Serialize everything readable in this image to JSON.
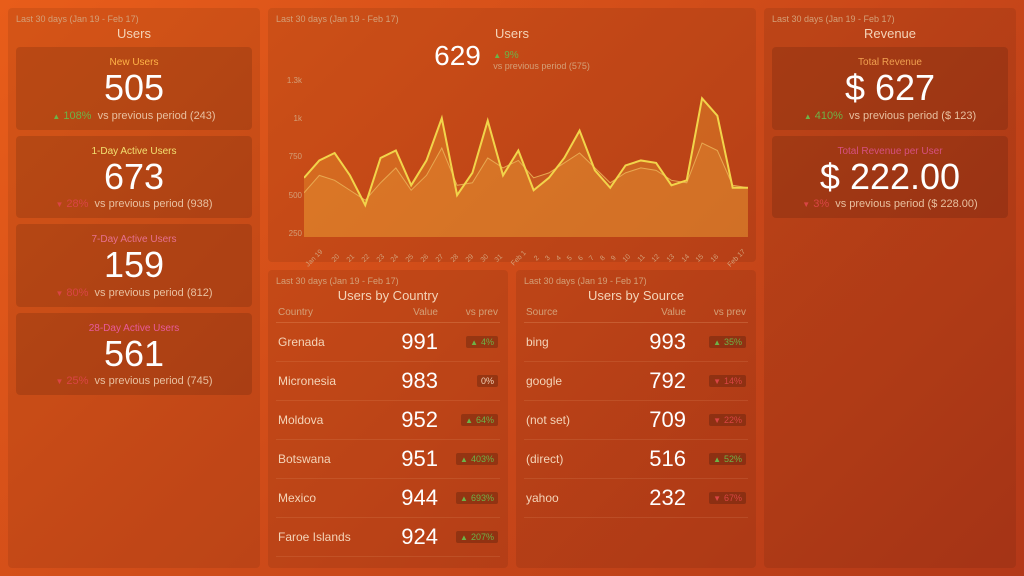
{
  "period": "Last 30 days (Jan 19 - Feb 17)",
  "users_section": {
    "title": "Users",
    "cards": [
      {
        "label": "New Users",
        "value": "505",
        "delta": "108%",
        "dir": "up",
        "prev": "vs previous period (243)"
      },
      {
        "label": "1-Day Active Users",
        "value": "673",
        "delta": "28%",
        "dir": "down",
        "prev": "vs previous period (938)"
      },
      {
        "label": "7-Day Active Users",
        "value": "159",
        "delta": "80%",
        "dir": "down",
        "prev": "vs previous period (812)"
      },
      {
        "label": "28-Day Active Users",
        "value": "561",
        "delta": "25%",
        "dir": "down",
        "prev": "vs previous period (745)"
      }
    ]
  },
  "revenue_section": {
    "title": "Revenue",
    "cards": [
      {
        "label": "Total Revenue",
        "value": "$ 627",
        "delta": "410%",
        "dir": "up",
        "prev": "vs previous period ($ 123)"
      },
      {
        "label": "Total Revenue per User",
        "value": "$ 222.00",
        "delta": "3%",
        "dir": "down",
        "prev": "vs previous period ($ 228.00)"
      }
    ]
  },
  "chart": {
    "title": "Users",
    "value": "629",
    "delta": "9%",
    "dir": "up",
    "prev": "vs previous period (575)"
  },
  "chart_data": {
    "type": "line",
    "title": "Users",
    "ylabel": "",
    "xlabel": "",
    "ylim": [
      0,
      1300
    ],
    "categories": [
      "Jan 19",
      "20",
      "21",
      "22",
      "23",
      "24",
      "25",
      "26",
      "27",
      "28",
      "29",
      "30",
      "31",
      "Feb 1",
      "2",
      "3",
      "4",
      "5",
      "6",
      "7",
      "8",
      "9",
      "10",
      "11",
      "12",
      "13",
      "14",
      "15",
      "16",
      "Feb 17"
    ],
    "series": [
      {
        "name": "current",
        "values": [
          480,
          620,
          680,
          500,
          260,
          640,
          700,
          420,
          620,
          960,
          340,
          520,
          940,
          500,
          700,
          380,
          480,
          640,
          860,
          540,
          400,
          580,
          620,
          600,
          420,
          460,
          1120,
          980,
          400,
          400
        ]
      },
      {
        "name": "previous",
        "values": [
          360,
          500,
          460,
          380,
          300,
          440,
          560,
          380,
          500,
          720,
          420,
          440,
          640,
          560,
          620,
          480,
          520,
          600,
          680,
          560,
          440,
          520,
          560,
          540,
          460,
          440,
          760,
          700,
          420,
          400
        ]
      }
    ]
  },
  "by_country": {
    "title": "Users by Country",
    "cols": [
      "Country",
      "Value",
      "vs prev"
    ],
    "rows": [
      {
        "c": "Grenada",
        "v": "991",
        "d": "4%",
        "dir": "up"
      },
      {
        "c": "Micronesia",
        "v": "983",
        "d": "0%",
        "dir": "flat"
      },
      {
        "c": "Moldova",
        "v": "952",
        "d": "64%",
        "dir": "up"
      },
      {
        "c": "Botswana",
        "v": "951",
        "d": "403%",
        "dir": "up"
      },
      {
        "c": "Mexico",
        "v": "944",
        "d": "693%",
        "dir": "up"
      },
      {
        "c": "Faroe Islands",
        "v": "924",
        "d": "207%",
        "dir": "up"
      }
    ]
  },
  "by_source": {
    "title": "Users by Source",
    "cols": [
      "Source",
      "Value",
      "vs prev"
    ],
    "rows": [
      {
        "c": "bing",
        "v": "993",
        "d": "35%",
        "dir": "up"
      },
      {
        "c": "google",
        "v": "792",
        "d": "14%",
        "dir": "down"
      },
      {
        "c": "(not set)",
        "v": "709",
        "d": "22%",
        "dir": "down"
      },
      {
        "c": "(direct)",
        "v": "516",
        "d": "52%",
        "dir": "up"
      },
      {
        "c": "yahoo",
        "v": "232",
        "d": "67%",
        "dir": "down"
      }
    ]
  }
}
